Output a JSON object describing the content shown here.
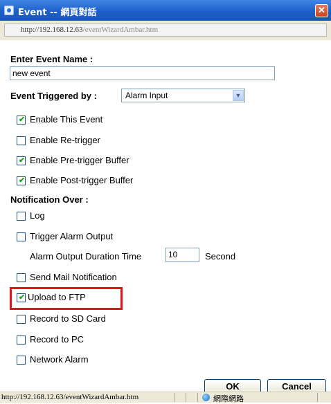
{
  "window": {
    "title": "Event -- 網頁對話",
    "close_symbol": "✕",
    "address_host": "http://192.168.12.63",
    "address_path": "/eventWizardAmbar.htm"
  },
  "form": {
    "event_name_label": "Enter Event Name :",
    "event_name_value": "new event",
    "trigger_label": "Event Triggered by :",
    "trigger_selected": "Alarm Input",
    "options": {
      "enable_event": {
        "label": "Enable This Event",
        "checked": true
      },
      "enable_retrigger": {
        "label": "Enable Re-trigger",
        "checked": false
      },
      "enable_pretrigger": {
        "label": "Enable Pre-trigger Buffer",
        "checked": true
      },
      "enable_posttrigger": {
        "label": "Enable Post-trigger Buffer",
        "checked": true
      }
    },
    "notification_label": "Notification Over :",
    "notifications": {
      "log": {
        "label": "Log",
        "checked": false
      },
      "trigger_alarm": {
        "label": "Trigger Alarm Output",
        "checked": false
      },
      "send_mail": {
        "label": "Send Mail Notification",
        "checked": false
      },
      "upload_ftp": {
        "label": "Upload to FTP",
        "checked": true
      },
      "record_sd": {
        "label": "Record to SD Card",
        "checked": false
      },
      "record_pc": {
        "label": "Record to PC",
        "checked": false
      },
      "network_alarm": {
        "label": "Network Alarm",
        "checked": false
      }
    },
    "alarm_duration_label": "Alarm Output Duration Time",
    "alarm_duration_value": "10",
    "alarm_duration_unit": "Second",
    "ok_label": "OK",
    "cancel_label": "Cancel"
  },
  "status": {
    "url": "http://192.168.12.63/eventWizardAmbar.htm",
    "zone": "網際網路"
  },
  "icons": {
    "title": "ie-page-icon",
    "status": "globe-icon",
    "checkmark": "✔",
    "dropdown": "▼"
  },
  "colors": {
    "titlebar": "#1d5fc9",
    "highlight": "#e8101a",
    "checkmark": "#21a121"
  }
}
